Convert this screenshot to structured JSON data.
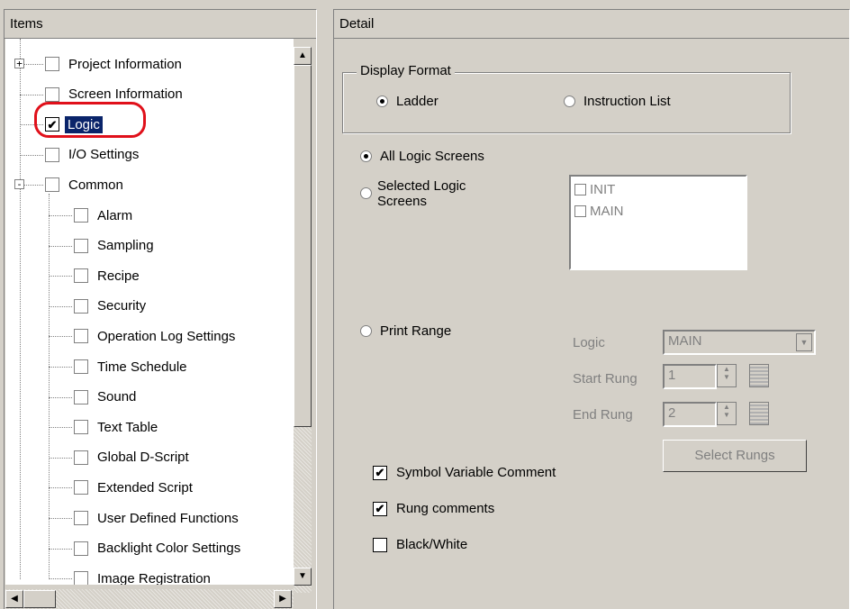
{
  "items_panel": {
    "title": "Items",
    "tree": [
      {
        "label": "Project Information",
        "checked": false,
        "expander": "+"
      },
      {
        "label": "Screen Information",
        "checked": false
      },
      {
        "label": "Logic",
        "checked": true,
        "selected": true
      },
      {
        "label": "I/O Settings",
        "checked": false
      },
      {
        "label": "Common",
        "checked": false,
        "expander": "-"
      },
      {
        "label": "Alarm",
        "checked": false
      },
      {
        "label": "Sampling",
        "checked": false
      },
      {
        "label": "Recipe",
        "checked": false
      },
      {
        "label": "Security",
        "checked": false
      },
      {
        "label": "Operation Log Settings",
        "checked": false
      },
      {
        "label": "Time Schedule",
        "checked": false
      },
      {
        "label": "Sound",
        "checked": false
      },
      {
        "label": "Text Table",
        "checked": false
      },
      {
        "label": "Global D-Script",
        "checked": false
      },
      {
        "label": "Extended Script",
        "checked": false
      },
      {
        "label": "User Defined Functions",
        "checked": false
      },
      {
        "label": "Backlight Color Settings",
        "checked": false
      },
      {
        "label": "Image Registration",
        "checked": false
      }
    ]
  },
  "detail_panel": {
    "title": "Detail",
    "display_format": {
      "title": "Display Format",
      "ladder": "Ladder",
      "instruction_list": "Instruction List"
    },
    "all_logic_screens": "All Logic Screens",
    "selected_logic_screens": "Selected Logic Screens",
    "screens": [
      "INIT",
      "MAIN"
    ],
    "print_range": "Print Range",
    "logic_label": "Logic",
    "logic_value": "MAIN",
    "start_rung_label": "Start Rung",
    "start_rung_value": "1",
    "end_rung_label": "End Rung",
    "end_rung_value": "2",
    "select_rungs": "Select Rungs",
    "symbol_variable_comment": "Symbol Variable Comment",
    "rung_comments": "Rung comments",
    "black_white": "Black/White"
  }
}
